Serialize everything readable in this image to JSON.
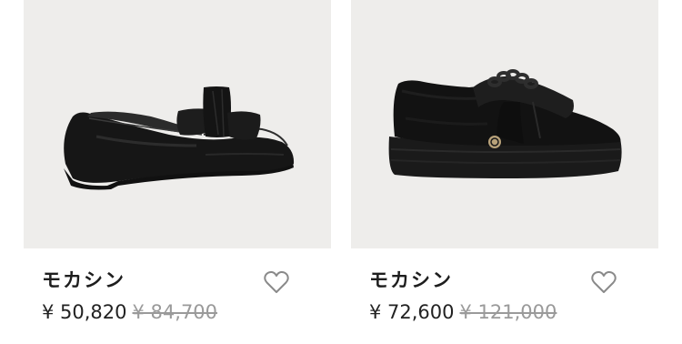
{
  "products": [
    {
      "name": "モカシン",
      "price": "¥ 50,820",
      "original_price": "¥ 84,700",
      "image": "black-leather-loafer-with-bow",
      "favorite_icon": "heart-outline-icon"
    },
    {
      "name": "モカシン",
      "price": "¥ 72,600",
      "original_price": "¥ 121,000",
      "image": "black-suede-platform-creeper-with-chain",
      "favorite_icon": "heart-outline-icon"
    }
  ],
  "colors": {
    "image_bg": "#eeedeb",
    "text": "#222222",
    "strike_price": "#9a9a9a"
  }
}
